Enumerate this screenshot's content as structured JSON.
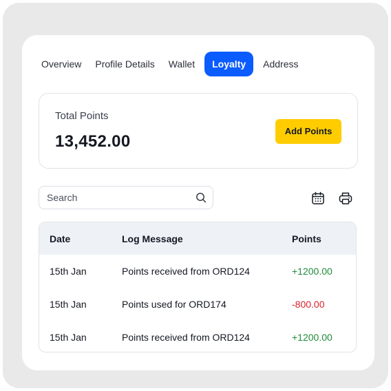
{
  "tabs": [
    {
      "label": "Overview",
      "active": false
    },
    {
      "label": "Profile Details",
      "active": false
    },
    {
      "label": "Wallet",
      "active": false
    },
    {
      "label": "Loyalty",
      "active": true
    },
    {
      "label": "Address",
      "active": false
    }
  ],
  "summary": {
    "label": "Total Points",
    "value": "13,452.00",
    "add_button": "Add Points"
  },
  "search": {
    "placeholder": "Search",
    "value": ""
  },
  "toolbar": {
    "calendar_icon": "calendar-icon",
    "print_icon": "printer-icon"
  },
  "table": {
    "headers": [
      "Date",
      "Log Message",
      "Points"
    ],
    "rows": [
      {
        "date": "15th Jan",
        "message": "Points received from ORD124",
        "points": "+1200.00",
        "type": "credit"
      },
      {
        "date": "15th Jan",
        "message": "Points used for ORD174",
        "points": "-800.00",
        "type": "debit"
      },
      {
        "date": "15th Jan",
        "message": "Points received from ORD124",
        "points": "+1200.00",
        "type": "credit"
      }
    ]
  },
  "colors": {
    "accent": "#0b5cff",
    "button": "#ffcc00",
    "credit": "#1f8a3a",
    "debit": "#d6202b"
  }
}
